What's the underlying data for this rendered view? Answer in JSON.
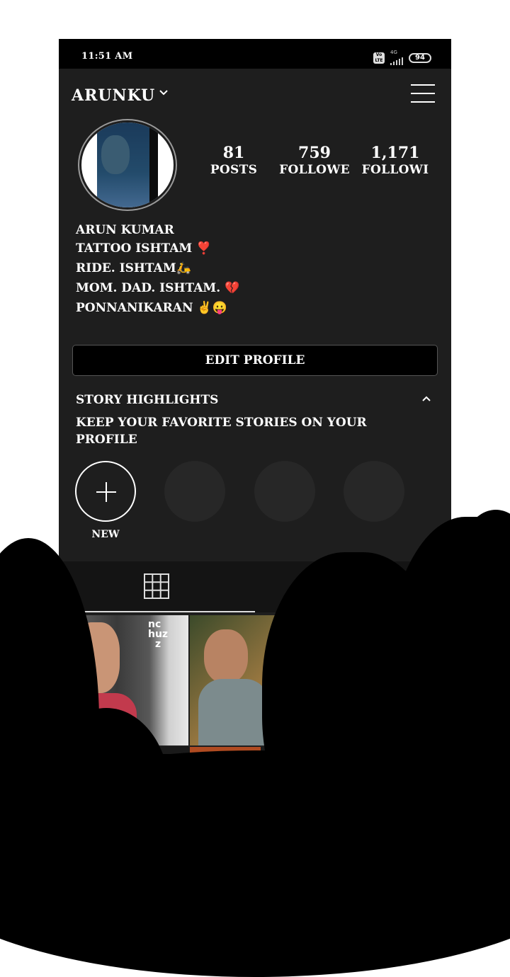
{
  "status_bar": {
    "time": "11:51 AM",
    "network": "4G",
    "volte": "Vo LTE",
    "battery": "94"
  },
  "header": {
    "username": "ARUNKU"
  },
  "stats": [
    {
      "value": "81",
      "label": "POSTS"
    },
    {
      "value": "759",
      "label": "FOLLOWE"
    },
    {
      "value": "1,171",
      "label": "FOLLOWI"
    }
  ],
  "bio": {
    "name": "ARUN KUMAR",
    "lines": [
      "TATTOO ISHTAM ❣️",
      "RIDE. ISHTAM🛵",
      "MOM. DAD. ISHTAM. 💔",
      "PONNANIKARAN ✌️😛"
    ]
  },
  "edit_profile": "EDIT PROFILE",
  "highlights": {
    "title": "STORY HIGHLIGHTS",
    "description": "KEEP YOUR FAVORITE STORIES ON YOUR PROFILE",
    "new_label": "NEW"
  },
  "posts": [
    {
      "caption": "nc\nhuz\nz"
    }
  ],
  "colors": {
    "background": "#1e1e1e",
    "text": "#ffffff",
    "button": "#000000"
  }
}
